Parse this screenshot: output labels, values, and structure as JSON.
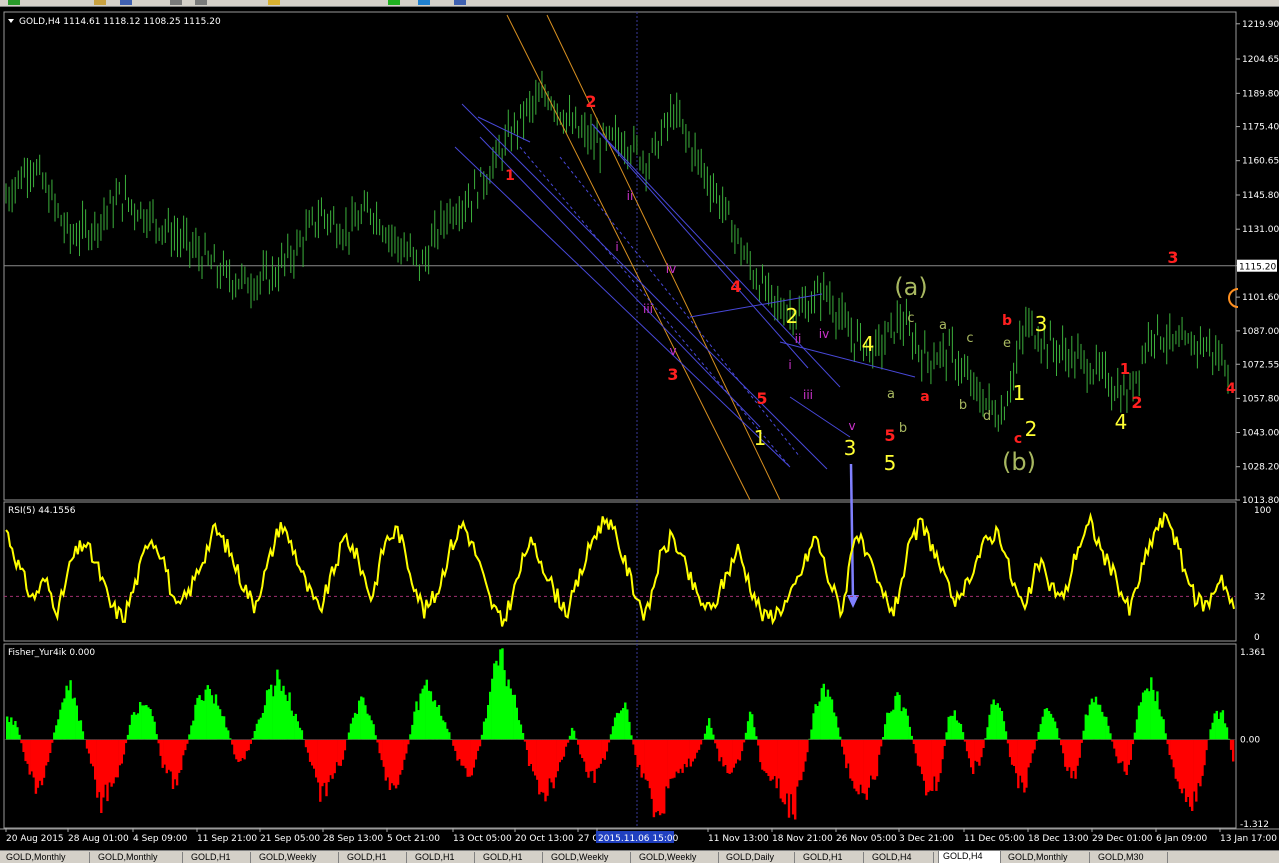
{
  "colors": {
    "price_bars": "#3cb03c",
    "rsi_line": "#ffff00",
    "fisher_pos": "#00ff00",
    "fisher_neg": "#ff0000",
    "red_label": "#ff2020",
    "yellow_label": "#ffff33",
    "magenta_label": "#cc33cc",
    "olive_label": "#a8b860",
    "trendline_blue": "#4848d8",
    "trendline_orange": "#d89020",
    "grid": "#444444",
    "axis_text": "#ffffff"
  },
  "tabs": [
    {
      "label": "GOLD,Monthly"
    },
    {
      "label": "GOLD,Monthly"
    },
    {
      "label": "GOLD,H1"
    },
    {
      "label": "GOLD,Weekly"
    },
    {
      "label": "GOLD,H1"
    },
    {
      "label": "GOLD,H1"
    },
    {
      "label": "GOLD,H1"
    },
    {
      "label": "GOLD,Weekly"
    },
    {
      "label": "GOLD,Weekly"
    },
    {
      "label": "GOLD,Daily"
    },
    {
      "label": "GOLD,H1"
    },
    {
      "label": "GOLD,H4"
    },
    {
      "label": "GOLD,H4",
      "active": true
    },
    {
      "label": "GOLD,Monthly"
    },
    {
      "label": "GOLD,M30"
    }
  ],
  "panels": {
    "price": {
      "title": "GOLD,H4  1114.61 1118.12 1108.25 1115.20"
    },
    "rsi": {
      "title": "RSI(5) 44.1556"
    },
    "fisher": {
      "title": "Fisher_Yur4ik 0.000"
    }
  },
  "chart_data": [
    {
      "type": "line",
      "title": "GOLD,H4  1114.61 1118.12 1108.25 1115.20",
      "y_ticks": [
        "1219.90",
        "1204.65",
        "1189.80",
        "1175.40",
        "1160.65",
        "1145.80",
        "1131.00",
        "1115.20",
        "1101.60",
        "1087.00",
        "1072.55",
        "1057.80",
        "1043.00",
        "1028.20",
        "1013.80"
      ],
      "ylim": [
        1013.8,
        1225
      ],
      "current_price": "1115.20",
      "x_ticks": [
        "20 Aug 2015",
        "28 Aug 01:00",
        "4 Sep 09:00",
        "11 Sep 21:00",
        "21 Sep 05:00",
        "28 Sep 13:00",
        "5 Oct 21:00",
        "13 Oct 05:00",
        "20 Oct 13:00",
        "27 Oct 21:00",
        "2015.11.06 15:00",
        "11 Nov 13:00",
        "18 Nov 21:00",
        "26 Nov 05:00",
        "3 Dec 21:00",
        "11 Dec 05:00",
        "18 Dec 13:00",
        "29 Dec 01:00",
        "6 Jan 09:00",
        "13 Jan 17:00"
      ],
      "series": [
        {
          "x": [
            0,
            4,
            7,
            10,
            14,
            18,
            22,
            26,
            30,
            34,
            38,
            42,
            46,
            50,
            54,
            58,
            62,
            66,
            70,
            74,
            78,
            82,
            86,
            90,
            94,
            98,
            102,
            106,
            110,
            114,
            118,
            122,
            126,
            130,
            134,
            138,
            142,
            146,
            150,
            154,
            158,
            162,
            166,
            170,
            174,
            178,
            182,
            186,
            190,
            194
          ],
          "values": [
            1145,
            1160,
            1145,
            1128,
            1132,
            1145,
            1138,
            1130,
            1122,
            1112,
            1108,
            1110,
            1122,
            1138,
            1130,
            1140,
            1125,
            1115,
            1138,
            1145,
            1162,
            1180,
            1190,
            1175,
            1168,
            1170,
            1160,
            1182,
            1160,
            1140,
            1115,
            1098,
            1095,
            1105,
            1085,
            1078,
            1092,
            1075,
            1078,
            1060,
            1050,
            1090,
            1080,
            1075,
            1068,
            1058,
            1088,
            1080,
            1082,
            1072
          ]
        }
      ],
      "wave_labels": [
        {
          "text": "1",
          "color": "red"
        },
        {
          "text": "2",
          "color": "red"
        },
        {
          "text": "3",
          "color": "red"
        },
        {
          "text": "4",
          "color": "red"
        },
        {
          "text": "5",
          "color": "red"
        },
        {
          "text": "5",
          "color": "red"
        },
        {
          "text": "3",
          "color": "red"
        },
        {
          "text": "1",
          "color": "red"
        },
        {
          "text": "2",
          "color": "red"
        },
        {
          "text": "4",
          "color": "red"
        },
        {
          "text": "a",
          "color": "red"
        },
        {
          "text": "b",
          "color": "red"
        },
        {
          "text": "c",
          "color": "red"
        },
        {
          "text": "1",
          "color": "yellow"
        },
        {
          "text": "2",
          "color": "yellow"
        },
        {
          "text": "3",
          "color": "yellow"
        },
        {
          "text": "4",
          "color": "yellow"
        },
        {
          "text": "5",
          "color": "yellow"
        },
        {
          "text": "1",
          "color": "yellow"
        },
        {
          "text": "2",
          "color": "yellow"
        },
        {
          "text": "3",
          "color": "yellow"
        },
        {
          "text": "4",
          "color": "yellow"
        },
        {
          "text": "i",
          "color": "magenta"
        },
        {
          "text": "ii",
          "color": "magenta"
        },
        {
          "text": "iii",
          "color": "magenta"
        },
        {
          "text": "iv",
          "color": "magenta"
        },
        {
          "text": "v",
          "color": "magenta"
        },
        {
          "text": "i",
          "color": "magenta"
        },
        {
          "text": "ii",
          "color": "magenta"
        },
        {
          "text": "iii",
          "color": "magenta"
        },
        {
          "text": "iv",
          "color": "magenta"
        },
        {
          "text": "v",
          "color": "magenta"
        },
        {
          "text": "(a)",
          "color": "olive"
        },
        {
          "text": "(b)",
          "color": "olive"
        },
        {
          "text": "a",
          "color": "olive"
        },
        {
          "text": "b",
          "color": "olive"
        },
        {
          "text": "c",
          "color": "olive"
        },
        {
          "text": "a",
          "color": "olive"
        },
        {
          "text": "b",
          "color": "olive"
        },
        {
          "text": "c",
          "color": "olive"
        },
        {
          "text": "d",
          "color": "olive"
        },
        {
          "text": "e",
          "color": "olive"
        }
      ]
    },
    {
      "type": "line",
      "title": "RSI(5) 44.1556",
      "y_ticks": [
        "100",
        "32",
        "0"
      ],
      "ylim": [
        0,
        100
      ],
      "level": 32,
      "series": [
        {
          "name": "RSI(5)",
          "values": [
            85,
            55,
            30,
            45,
            20,
            60,
            75,
            55,
            25,
            15,
            45,
            80,
            65,
            20,
            35,
            60,
            85,
            70,
            45,
            25,
            55,
            90,
            70,
            40,
            20,
            50,
            80,
            60,
            30,
            75,
            85,
            50,
            20,
            35,
            70,
            90,
            65,
            30,
            10,
            40,
            75,
            60,
            35,
            20,
            50,
            80,
            95,
            70,
            40,
            15,
            60,
            80,
            55,
            30,
            20,
            45,
            70,
            40,
            15,
            20,
            30,
            55,
            80,
            45,
            20,
            85,
            60,
            35,
            20,
            65,
            90,
            70,
            40,
            25,
            55,
            75,
            85,
            45,
            20,
            60,
            40,
            30,
            70,
            90,
            65,
            45,
            20,
            55,
            85,
            95,
            60,
            30,
            25,
            50,
            20
          ]
        }
      ]
    },
    {
      "type": "bar",
      "title": "Fisher_Yur4ik 0.000",
      "y_ticks": [
        "1.361",
        "0.00",
        "-1.312"
      ],
      "ylim": [
        -1.312,
        1.361
      ],
      "series": [
        {
          "name": "Fisher_Yur4ik",
          "values": [
            0.4,
            0.2,
            -0.5,
            -0.9,
            -0.3,
            0.5,
            0.8,
            0.3,
            -0.4,
            -1.0,
            -0.8,
            -0.3,
            0.4,
            0.6,
            0.3,
            -0.5,
            -0.7,
            -0.2,
            0.5,
            0.9,
            0.6,
            0.2,
            -0.4,
            -0.2,
            0.3,
            0.8,
            1.0,
            0.6,
            0.2,
            -0.4,
            -0.9,
            -0.6,
            -0.3,
            0.4,
            0.6,
            0.2,
            -0.5,
            -0.8,
            -0.3,
            0.5,
            0.9,
            0.6,
            0.2,
            -0.3,
            -0.6,
            -0.2,
            0.7,
            1.3,
            0.9,
            0.3,
            -0.5,
            -0.9,
            -0.7,
            -0.3,
            0.2,
            -0.4,
            -0.6,
            -0.3,
            0.3,
            0.6,
            -0.3,
            -0.8,
            -1.1,
            -0.9,
            -0.6,
            -0.4,
            -0.2,
            0.3,
            -0.3,
            -0.5,
            -0.3,
            0.5,
            -0.4,
            -0.6,
            -0.8,
            -1.2,
            -0.5,
            0.4,
            0.8,
            0.5,
            -0.4,
            -0.7,
            -0.9,
            -0.5,
            0.4,
            0.7,
            0.3,
            -0.4,
            -0.9,
            -0.6,
            0.5,
            0.3,
            -0.5,
            -0.3,
            0.6,
            0.4,
            -0.5,
            -0.8,
            -0.2,
            0.5,
            0.3,
            -0.4,
            -0.6,
            0.4,
            0.7,
            0.3,
            -0.4,
            -0.5,
            0.5,
            0.9,
            0.6,
            -0.3,
            -0.7,
            -1.0,
            -0.6,
            0.3,
            0.5,
            -0.3
          ]
        }
      ]
    }
  ]
}
